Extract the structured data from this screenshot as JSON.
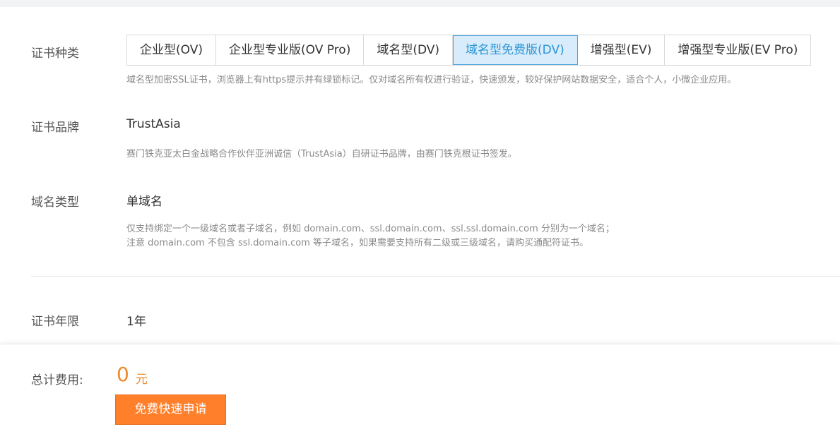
{
  "cert_type": {
    "label": "证书种类",
    "tabs": [
      {
        "label": "企业型(OV)"
      },
      {
        "label": "企业型专业版(OV Pro)"
      },
      {
        "label": "域名型(DV)"
      },
      {
        "label": "域名型免费版(DV)",
        "active": true
      },
      {
        "label": "增强型(EV)"
      },
      {
        "label": "增强型专业版(EV Pro)"
      }
    ],
    "description": "域名型加密SSL证书，浏览器上有https提示并有绿锁标记。仅对域名所有权进行验证，快速颁发，较好保护网站数据安全，适合个人，小微企业应用。"
  },
  "cert_brand": {
    "label": "证书品牌",
    "value": "TrustAsia",
    "description": "赛门铁克亚太白金战略合作伙伴亚洲诚信（TrustAsia）自研证书品牌，由赛门铁克根证书签发。"
  },
  "domain_type": {
    "label": "域名类型",
    "value": "单域名",
    "description_line1": "仅支持绑定一个一级域名或者子域名，例如 domain.com、ssl.domain.com、ssl.ssl.domain.com 分别为一个域名；",
    "description_line2": "注意 domain.com 不包含 ssl.domain.com 等子域名，如果需要支持所有二级或三级域名，请购买通配符证书。"
  },
  "cert_term": {
    "label": "证书年限",
    "value": "1年"
  },
  "footer": {
    "total_label": "总计费用:",
    "price": "0",
    "currency": "元",
    "apply_button": "免费快速申请"
  },
  "colors": {
    "accent_blue": "#2b95d6",
    "active_tab_bg": "#d9ecfb",
    "price_orange": "#f08a2c",
    "button_orange": "#ff7f2a"
  }
}
